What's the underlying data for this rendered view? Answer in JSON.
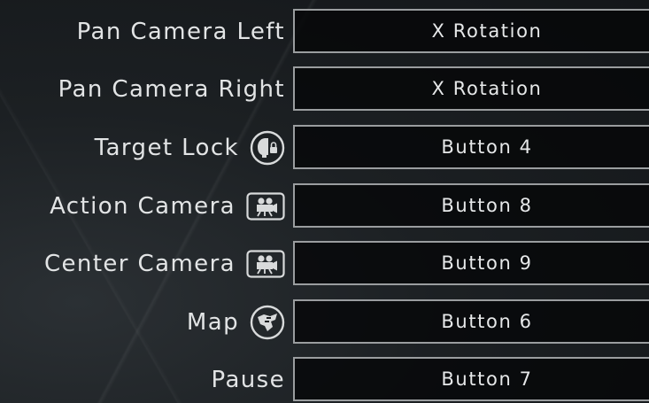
{
  "bindings": [
    {
      "action": "Pan Camera Left",
      "icon": "",
      "button": "X Rotation"
    },
    {
      "action": "Pan Camera Right",
      "icon": "",
      "button": "X Rotation"
    },
    {
      "action": "Target Lock",
      "icon": "target-lock-icon",
      "button": "Button 4"
    },
    {
      "action": "Action Camera",
      "icon": "camera-icon",
      "button": "Button 8"
    },
    {
      "action": "Center Camera",
      "icon": "camera-icon",
      "button": "Button 9"
    },
    {
      "action": "Map",
      "icon": "map-icon",
      "button": "Button 6"
    },
    {
      "action": "Pause",
      "icon": "",
      "button": "Button 7"
    }
  ]
}
